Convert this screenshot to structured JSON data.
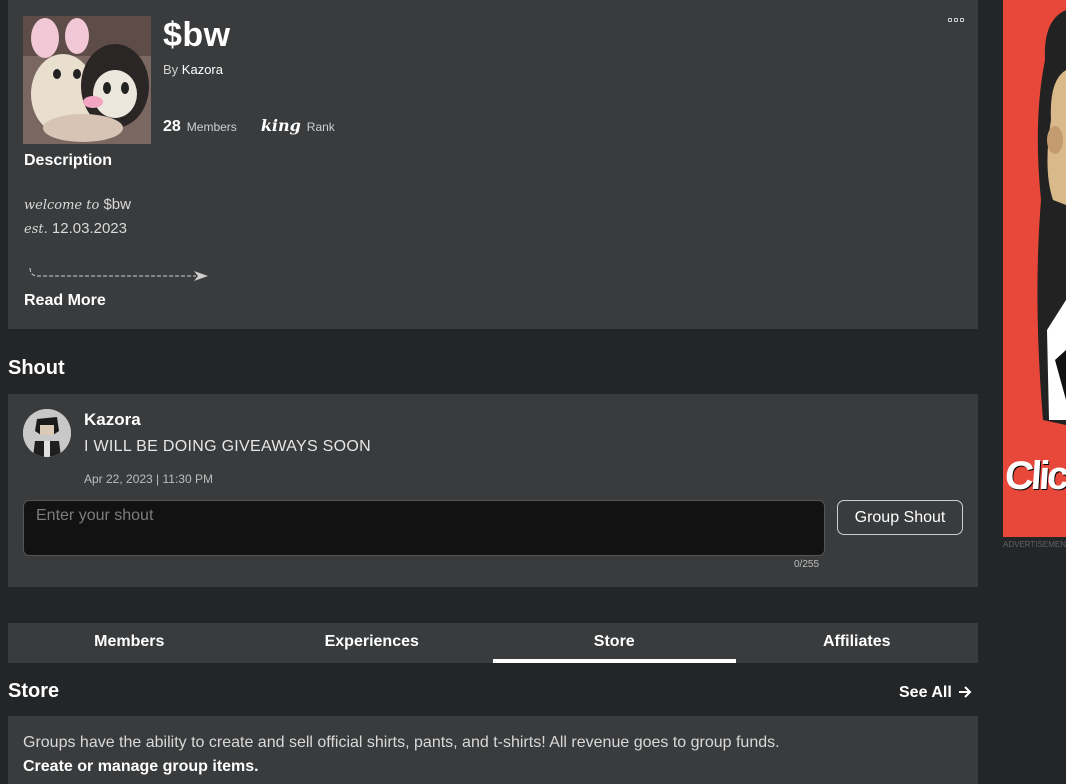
{
  "group": {
    "name": "$bw",
    "owner_prefix": "By",
    "owner": "Kazora",
    "member_count": "28",
    "members_label": "Members",
    "rank_name": "king",
    "rank_label": "Rank"
  },
  "description": {
    "title": "Description",
    "line1_italic": "welcome to",
    "line1_rest": " $bw",
    "line2_italic": "est.",
    "line2_rest": " 12.03.2023",
    "read_more": "Read More"
  },
  "shout": {
    "title": "Shout",
    "author": "Kazora",
    "text": "I WILL BE DOING GIVEAWAYS SOON",
    "date": "Apr 22, 2023 | 11:30 PM",
    "input_placeholder": "Enter your shout",
    "char_count": "0/255",
    "button_label": "Group Shout"
  },
  "tabs": [
    {
      "label": "Members",
      "active": false
    },
    {
      "label": "Experiences",
      "active": false
    },
    {
      "label": "Store",
      "active": true
    },
    {
      "label": "Affiliates",
      "active": false
    }
  ],
  "store": {
    "title": "Store",
    "see_all": "See All",
    "info": "Groups have the ability to create and sell official shirts, pants, and t-shirts! All revenue goes to group funds.",
    "link": "Create or manage group items."
  },
  "ad": {
    "text": "Click to",
    "label": "ADVERTISEMENT",
    "color": "#e8483a"
  },
  "colors": {
    "background": "#232527",
    "card": "#393b3d",
    "text": "#ffffff"
  }
}
